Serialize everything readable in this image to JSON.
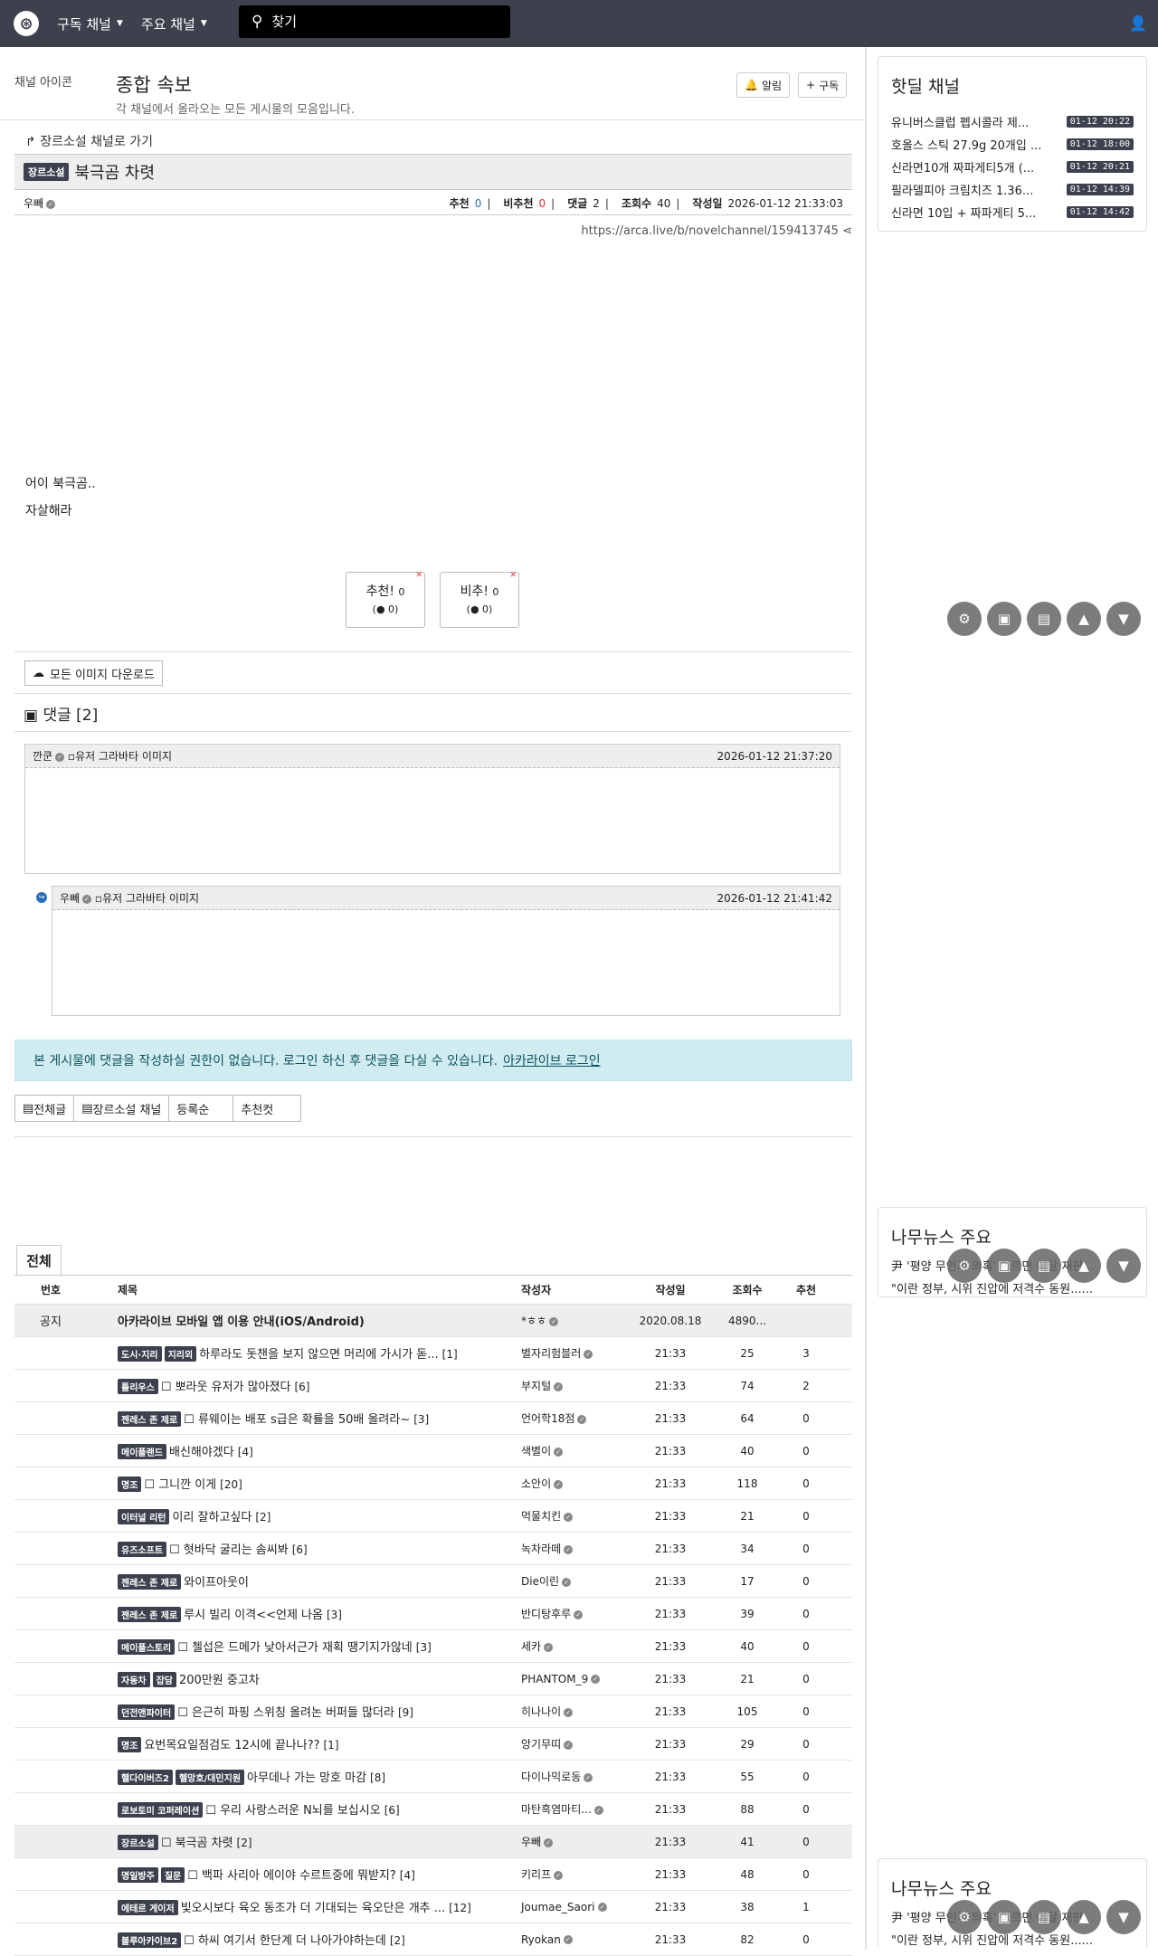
{
  "topbar": {
    "menu1": "구독 채널",
    "menu2": "주요 채널",
    "search_placeholder": "찾기"
  },
  "board": {
    "icon_alt": "채널 아이콘",
    "title": "종합 속보",
    "desc": "각 채널에서 올라오는 모든 게시물의 모음입니다.",
    "alarm": "알림",
    "subscribe": "구독"
  },
  "post": {
    "goto": "장르소설 채널로 가기",
    "badge": "장르소설",
    "title": "북극곰 차렷",
    "author": "우빼",
    "rec_label": "추천",
    "rec": "0",
    "unrec_label": "비추천",
    "unrec": "0",
    "cmt_label": "댓글",
    "cmt": "2",
    "views_label": "조회수",
    "views": "40",
    "date_label": "작성일",
    "date": "2026-01-12 21:33:03",
    "url": "https://arca.live/b/novelchannel/159413745",
    "line1": "어이 북극곰..",
    "line2": "자살해라",
    "up_label": "추천!",
    "up_count": "0",
    "up_sub": "0",
    "down_label": "비추!",
    "down_count": "0",
    "down_sub": "0",
    "download": "모든 이미지 다운로드"
  },
  "comments": {
    "header": "댓글 [2]",
    "c1_name": "깐쿤",
    "c1_img": "유저 그라바타 이미지",
    "c1_date": "2026-01-12 21:37:20",
    "c2_name": "우빼",
    "c2_img": "유저 그라바타 이미지",
    "c2_date": "2026-01-12 21:41:42"
  },
  "notice": {
    "text": "본 게시물에 댓글을 작성하실 권한이 없습니다. 로그인 하신 후 댓글을 다실 수 있습니다.",
    "link": "아카라이브 로그인"
  },
  "filters": [
    "전체글",
    "장르소설 채널",
    "등록순",
    "추천컷"
  ],
  "list": {
    "tab": "전체",
    "headers": [
      "번호",
      "제목",
      "작성자",
      "작성일",
      "조회수",
      "추천"
    ],
    "rows": [
      {
        "no": "공지",
        "badges": [],
        "title": "아카라이브 모바일 앱 이용 안내(iOS/Android)",
        "cnt": "",
        "author": "*ㅎㅎ",
        "date": "2020.08.18",
        "views": "4890...",
        "rec": "",
        "notice": true
      },
      {
        "no": "",
        "badges": [
          "도시·지리",
          "지리외"
        ],
        "title": "하루라도 돗챈을 보지 않으면 머리에 가시가 돋...",
        "cnt": "[1]",
        "author": "별자리험블러",
        "date": "21:33",
        "views": "25",
        "rec": "3"
      },
      {
        "no": "",
        "badges": [
          "틀리우스"
        ],
        "title": "☐ 뽀라웃 유저가 많아졌다",
        "cnt": "[6]",
        "author": "부지털",
        "date": "21:33",
        "views": "74",
        "rec": "2"
      },
      {
        "no": "",
        "badges": [
          "젠레스 존 제로"
        ],
        "title": "☐ 류웨이는 배포 s급은 확률을 50배 올려라~",
        "cnt": "[3]",
        "author": "언어학18점",
        "date": "21:33",
        "views": "64",
        "rec": "0"
      },
      {
        "no": "",
        "badges": [
          "메이플랜드"
        ],
        "title": "배신해야겠다",
        "cnt": "[4]",
        "author": "색별이",
        "date": "21:33",
        "views": "40",
        "rec": "0"
      },
      {
        "no": "",
        "badges": [
          "명조"
        ],
        "title": "☐ 그니깐 이게",
        "cnt": "[20]",
        "author": "소안이",
        "date": "21:33",
        "views": "118",
        "rec": "0"
      },
      {
        "no": "",
        "badges": [
          "이터널 리턴"
        ],
        "title": "이리 잘하고싶다",
        "cnt": "[2]",
        "author": "먹물치킨",
        "date": "21:33",
        "views": "21",
        "rec": "0"
      },
      {
        "no": "",
        "badges": [
          "유즈소프트"
        ],
        "title": "☐ 혓바닥 굴리는 솜씨봐",
        "cnt": "[6]",
        "author": "녹차라떼",
        "date": "21:33",
        "views": "34",
        "rec": "0"
      },
      {
        "no": "",
        "badges": [
          "젠레스 존 제로"
        ],
        "title": "와이프아웃이",
        "cnt": "",
        "author": "Die이린",
        "date": "21:33",
        "views": "17",
        "rec": "0"
      },
      {
        "no": "",
        "badges": [
          "젠레스 존 제로"
        ],
        "title": "루시 빌리 이격<<언제 나옴",
        "cnt": "[3]",
        "author": "반디탕후루",
        "date": "21:33",
        "views": "39",
        "rec": "0"
      },
      {
        "no": "",
        "badges": [
          "메이플스토리"
        ],
        "title": "☐ 첼섭은 드메가 낮아서근가 재획 땡기지가않네",
        "cnt": "[3]",
        "author": "세카",
        "date": "21:33",
        "views": "40",
        "rec": "0"
      },
      {
        "no": "",
        "badges": [
          "자동차",
          "잡담"
        ],
        "title": "200만원 중고차",
        "cnt": "",
        "author": "PHANTOM_9",
        "date": "21:33",
        "views": "21",
        "rec": "0"
      },
      {
        "no": "",
        "badges": [
          "던전앤파이터"
        ],
        "title": "☐ 은근히 파핑 스위칭 올려논 버퍼들 많더라",
        "cnt": "[9]",
        "author": "히나나이",
        "date": "21:33",
        "views": "105",
        "rec": "0"
      },
      {
        "no": "",
        "badges": [
          "명조"
        ],
        "title": "요번목요일점검도 12시에 끝나나??",
        "cnt": "[1]",
        "author": "앙기무띠",
        "date": "21:33",
        "views": "29",
        "rec": "0"
      },
      {
        "no": "",
        "badges": [
          "헬다이버즈2",
          "헬망호/대민지원"
        ],
        "title": "아무데나 가는 망호 마감",
        "cnt": "[8]",
        "author": "다이나믹로동",
        "date": "21:33",
        "views": "55",
        "rec": "0"
      },
      {
        "no": "",
        "badges": [
          "로보토미 코퍼레이션"
        ],
        "title": "☐ 우리 사랑스러운 N뇌를 보십시오",
        "cnt": "[6]",
        "author": "마탄흑염마티...",
        "date": "21:33",
        "views": "88",
        "rec": "0"
      },
      {
        "no": "",
        "badges": [
          "장르소설"
        ],
        "title": "☐ 북극곰 차렷",
        "cnt": "[2]",
        "author": "우빼",
        "date": "21:33",
        "views": "41",
        "rec": "0",
        "hl": true
      },
      {
        "no": "",
        "badges": [
          "명일방주",
          "질문"
        ],
        "title": "☐ 백파 사리아 에이야 수르트중에 뭐받지?",
        "cnt": "[4]",
        "author": "키리프",
        "date": "21:33",
        "views": "48",
        "rec": "0"
      },
      {
        "no": "",
        "badges": [
          "에테르 게이저"
        ],
        "title": "빛오시보다 육오 동조가 더 기대되는 육오단은 개추 ...",
        "cnt": "[12]",
        "author": "Joumae_Saori",
        "date": "21:33",
        "views": "38",
        "rec": "1"
      },
      {
        "no": "",
        "badges": [
          "블루아카이브2"
        ],
        "title": "☐ 하씨 여기서 한단계 더 나아가야하는데",
        "cnt": "[2]",
        "author": "Ryokan",
        "date": "21:33",
        "views": "82",
        "rec": "0"
      }
    ]
  },
  "hot": {
    "title": "핫딜 채널",
    "items": [
      {
        "t": "유니버스클럽 펩시콜라 제...",
        "d": "01-12 20:22"
      },
      {
        "t": "호올스 스틱 27.9g 20개입 ...",
        "d": "01-12 18:00"
      },
      {
        "t": "신라면10개 짜파게티5개 (...",
        "d": "01-12 20:21"
      },
      {
        "t": "필라델피아 크림치즈 1.36...",
        "d": "01-12 14:39"
      },
      {
        "t": "신라면 10입 + 짜파게티 5...",
        "d": "01-12 14:42"
      }
    ]
  },
  "news": {
    "title": "나무뉴스 주요",
    "line1": "尹 '평양 무인기 의혹' 이르면 이달 재판...",
    "line2": "\"이란 정부, 시위 진압에 저격수 동원......"
  }
}
